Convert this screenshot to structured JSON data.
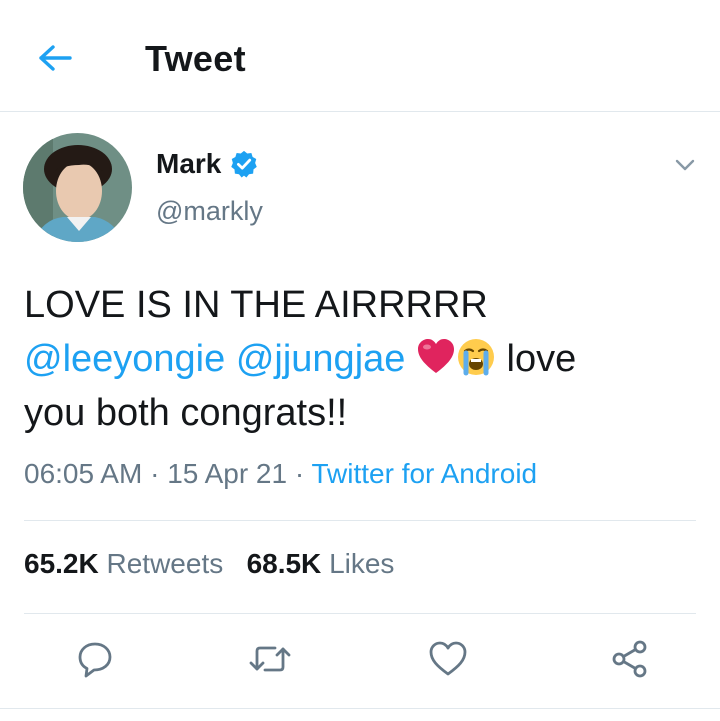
{
  "header": {
    "title": "Tweet",
    "back_icon": "arrow-left-icon"
  },
  "tweet": {
    "author_name": "Mark",
    "author_handle": "@markly",
    "verified": true,
    "text_line1": "LOVE IS IN THE AIRRRRR",
    "mention1": "@leeyongie",
    "mention2": "@jjungjae",
    "emoji1": "red-heart-emoji",
    "emoji2": "loudly-crying-face-emoji",
    "text_after_emoji": "love",
    "text_line3": "you both congrats!!",
    "time": "06:05 AM",
    "date": "15 Apr 21",
    "source": "Twitter for Android",
    "separator": " · "
  },
  "stats": {
    "retweets_count": "65.2K",
    "retweets_label": "Retweets",
    "likes_count": "68.5K",
    "likes_label": "Likes"
  },
  "actions": [
    "reply-icon",
    "retweet-icon",
    "like-icon",
    "share-icon"
  ],
  "colors": {
    "accent": "#1da1f2",
    "muted": "#657786",
    "text": "#14171a",
    "divider": "#e1e8ed",
    "heart": "#e0245e"
  }
}
